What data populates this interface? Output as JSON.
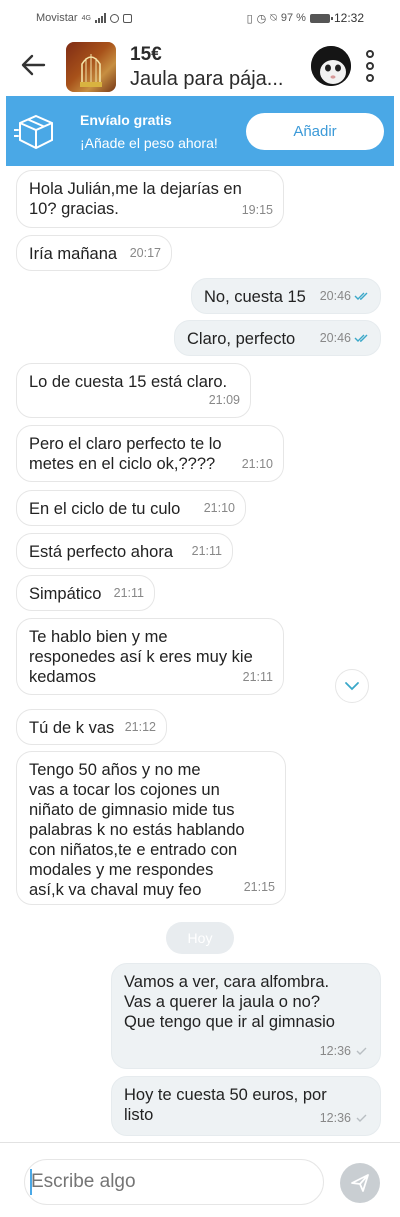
{
  "status_bar": {
    "carrier": "Movistar",
    "network": "4G",
    "battery": "97 %",
    "time": "12:32"
  },
  "header": {
    "price": "15€",
    "title": "Jaula para pája...",
    "back_icon": "arrow-left-icon",
    "menu_icon": "more-vertical-icon"
  },
  "banner": {
    "title": "Envíalo gratis",
    "subtitle": "¡Añade el peso ahora!",
    "button_label": "Añadir",
    "icon": "package-icon",
    "color": "#4aa8e6"
  },
  "messages": [
    {
      "dir": "in",
      "text": "Hola Julián,me la dejarías en\n10? gracias.",
      "time": "19:15"
    },
    {
      "dir": "in",
      "text": "Iría mañana",
      "time": "20:17"
    },
    {
      "dir": "out",
      "text": "No, cuesta 15",
      "time": "20:46",
      "status": "read"
    },
    {
      "dir": "out",
      "text": "Claro, perfecto",
      "time": "20:46",
      "status": "read"
    },
    {
      "dir": "in",
      "text": "Lo de cuesta 15 está claro.",
      "time": "21:09"
    },
    {
      "dir": "in",
      "text": "Pero el claro perfecto te lo\nmetes en el ciclo ok,????",
      "time": "21:10"
    },
    {
      "dir": "in",
      "text": "En el ciclo de tu culo",
      "time": "21:10"
    },
    {
      "dir": "in",
      "text": "Está perfecto ahora",
      "time": "21:11"
    },
    {
      "dir": "in",
      "text": "Simpático",
      "time": "21:11"
    },
    {
      "dir": "in",
      "text": "Te hablo bien y me\nresponedes así k eres muy kie\nkedamos",
      "time": "21:11"
    },
    {
      "dir": "in",
      "text": "Tú de k vas",
      "time": "21:12"
    },
    {
      "dir": "in",
      "text": "Tengo 50 años y no me\nvas a tocar los cojones un\nniñato de gimnasio mide tus\npalabras k no estás hablando\ncon niñatos,te e entrado con\nmodales y me respondes\nasí,k va chaval muy feo",
      "time": "21:15"
    },
    {
      "dir": "out",
      "text": "Vamos a ver, cara alfombra.\nVas a querer la jaula o no?\nQue tengo que ir al gimnasio",
      "time": "12:36",
      "status": "sent"
    },
    {
      "dir": "out",
      "text": "Hoy te cuesta 50 euros, por\nlisto",
      "time": "12:36",
      "status": "sent"
    }
  ],
  "date_separator": "Hoy",
  "composer": {
    "placeholder": "Escribe algo",
    "value": "",
    "send_icon": "send-icon"
  },
  "colors": {
    "accent": "#4aa8e6",
    "read_tick": "#3aa8c9",
    "sent_tick": "#b8bec2"
  }
}
